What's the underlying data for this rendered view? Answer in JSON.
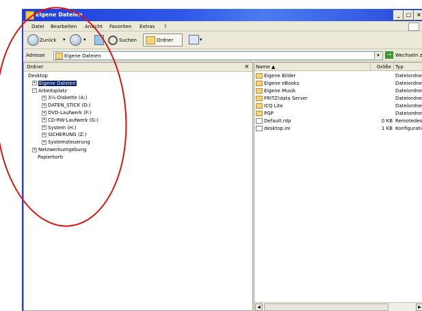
{
  "window": {
    "title": "Eigene Dateien"
  },
  "menubar": {
    "items": [
      "Datei",
      "Bearbeiten",
      "Ansicht",
      "Favoriten",
      "Extras",
      "?"
    ]
  },
  "toolbar": {
    "back_label": "Zurück",
    "search_label": "Suchen",
    "folders_label": "Ordner"
  },
  "address": {
    "label": "Adresse",
    "value": "Eigene Dateien",
    "go_label": "Wechseln zu"
  },
  "folders_pane": {
    "header": "Ordner",
    "close_label": "×"
  },
  "tree": [
    {
      "label": "Desktop",
      "expander": ""
    },
    {
      "label": "Eigene Dateien",
      "expander": "+",
      "selected": true
    },
    {
      "label": "Arbeitsplatz",
      "expander": "−"
    },
    {
      "label": "3½-Diskette (A:)",
      "expander": "+"
    },
    {
      "label": "DATEN_STICK (D:)",
      "expander": "+"
    },
    {
      "label": "DVD-Laufwerk (F:)",
      "expander": "+"
    },
    {
      "label": "CD-RW-Laufwerk (G:)",
      "expander": "+"
    },
    {
      "label": "System (H:)",
      "expander": "+"
    },
    {
      "label": "SICHERUNG (Z:)",
      "expander": "+"
    },
    {
      "label": "Systemsteuerung",
      "expander": "+"
    },
    {
      "label": "Netzwerkumgebung",
      "expander": "+"
    },
    {
      "label": "Papierkorb",
      "expander": ""
    }
  ],
  "file_list": {
    "columns": {
      "name": "Name ▲",
      "size": "Größe",
      "type": "Typ"
    },
    "rows": [
      {
        "name": "Eigene Bilder",
        "size": "",
        "type": "Dateiordner",
        "icon": "folder"
      },
      {
        "name": "Eigene eBooks",
        "size": "",
        "type": "Dateiordner",
        "icon": "folder"
      },
      {
        "name": "Eigene Musik",
        "size": "",
        "type": "Dateiordner",
        "icon": "folder"
      },
      {
        "name": "FRITZ!data Server",
        "size": "",
        "type": "Dateiordner",
        "icon": "folder"
      },
      {
        "name": "ICQ Lite",
        "size": "",
        "type": "Dateiordner",
        "icon": "folder"
      },
      {
        "name": "PGP",
        "size": "",
        "type": "Dateiordner",
        "icon": "folder"
      },
      {
        "name": "Default.rdp",
        "size": "0 KB",
        "type": "Remotedesktop",
        "icon": "file"
      },
      {
        "name": "desktop.ini",
        "size": "1 KB",
        "type": "Konfigurationseinst.",
        "icon": "file"
      }
    ]
  },
  "colors": {
    "titlebar": "#2f58e8",
    "selection": "#0a246a",
    "annotation": "#e01010"
  }
}
